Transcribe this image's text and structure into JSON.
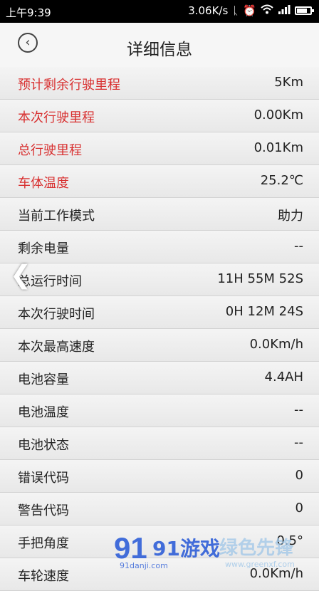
{
  "statusbar": {
    "time": "上午9:39",
    "speed": "3.06K/s",
    "icons": [
      "bluetooth-icon",
      "alarm-icon",
      "wifi-icon",
      "signal-icon",
      "battery-icon"
    ]
  },
  "header": {
    "title": "详细信息",
    "back_icon": "chevron-left-circle-icon"
  },
  "rows": [
    {
      "label": "预计剩余行驶里程",
      "value": "5Km",
      "highlight": true
    },
    {
      "label": "本次行驶里程",
      "value": "0.00Km",
      "highlight": true
    },
    {
      "label": "总行驶里程",
      "value": "0.01Km",
      "highlight": true
    },
    {
      "label": "车体温度",
      "value": "25.2℃",
      "highlight": true
    },
    {
      "label": "当前工作模式",
      "value": "助力",
      "highlight": false
    },
    {
      "label": "剩余电量",
      "value": "--",
      "highlight": false
    },
    {
      "label": "总运行时间",
      "value": "11H 55M 52S",
      "highlight": false
    },
    {
      "label": "本次行驶时间",
      "value": "0H 12M 24S",
      "highlight": false
    },
    {
      "label": "本次最高速度",
      "value": "0.0Km/h",
      "highlight": false
    },
    {
      "label": "电池容量",
      "value": "4.4AH",
      "highlight": false
    },
    {
      "label": "电池温度",
      "value": "--",
      "highlight": false
    },
    {
      "label": "电池状态",
      "value": "--",
      "highlight": false
    },
    {
      "label": "错误代码",
      "value": "0",
      "highlight": false
    },
    {
      "label": "警告代码",
      "value": "0",
      "highlight": false
    },
    {
      "label": "手把角度",
      "value": "0.5°",
      "highlight": false
    },
    {
      "label": "车轮速度",
      "value": "0.0Km/h",
      "highlight": false
    }
  ],
  "watermark": {
    "brand": "91游戏",
    "sub": "91danji.com",
    "brand2": "绿色先锋",
    "sub2": "www.greenxf.com"
  },
  "colors": {
    "highlight_label": "#d83030",
    "accent_brand": "#2f5fd8"
  }
}
